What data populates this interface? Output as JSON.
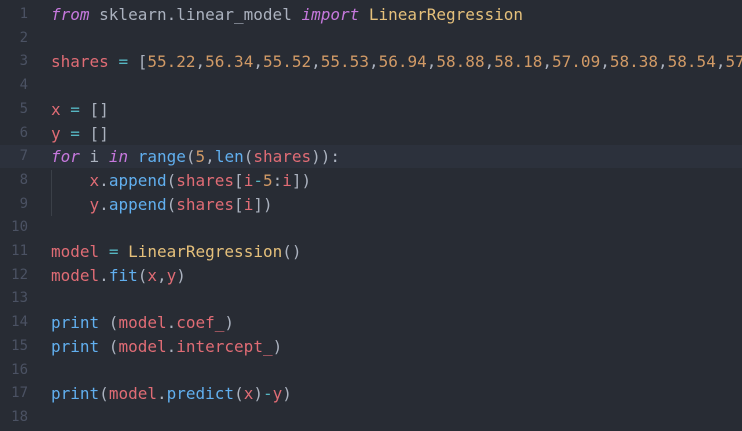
{
  "editor": {
    "language": "python",
    "current_line": 7,
    "colors": {
      "background": "#282c34",
      "keyword": "#c678dd",
      "variable": "#e06c75",
      "number": "#d19a66",
      "function": "#61afef",
      "class": "#e5c07b",
      "operator": "#56b6c2",
      "line_number": "#4b5263"
    },
    "lines": [
      {
        "no": "1",
        "tokens": [
          {
            "t": "kw",
            "v": "from"
          },
          {
            "t": "plain",
            "v": " sklearn.linear_model "
          },
          {
            "t": "kw",
            "v": "import"
          },
          {
            "t": "plain",
            "v": " "
          },
          {
            "t": "cls",
            "v": "LinearRegression"
          }
        ]
      },
      {
        "no": "2",
        "tokens": []
      },
      {
        "no": "3",
        "tokens": [
          {
            "t": "var",
            "v": "shares"
          },
          {
            "t": "plain",
            "v": " "
          },
          {
            "t": "op",
            "v": "="
          },
          {
            "t": "plain",
            "v": " ["
          },
          {
            "t": "num",
            "v": "55.22"
          },
          {
            "t": "plain",
            "v": ","
          },
          {
            "t": "num",
            "v": "56.34"
          },
          {
            "t": "plain",
            "v": ","
          },
          {
            "t": "num",
            "v": "55.52"
          },
          {
            "t": "plain",
            "v": ","
          },
          {
            "t": "num",
            "v": "55.53"
          },
          {
            "t": "plain",
            "v": ","
          },
          {
            "t": "num",
            "v": "56.94"
          },
          {
            "t": "plain",
            "v": ","
          },
          {
            "t": "num",
            "v": "58.88"
          },
          {
            "t": "plain",
            "v": ","
          },
          {
            "t": "num",
            "v": "58.18"
          },
          {
            "t": "plain",
            "v": ","
          },
          {
            "t": "num",
            "v": "57.09"
          },
          {
            "t": "plain",
            "v": ","
          },
          {
            "t": "num",
            "v": "58.38"
          },
          {
            "t": "plain",
            "v": ","
          },
          {
            "t": "num",
            "v": "58.54"
          },
          {
            "t": "plain",
            "v": ","
          },
          {
            "t": "num",
            "v": "57"
          }
        ]
      },
      {
        "no": "4",
        "tokens": []
      },
      {
        "no": "5",
        "tokens": [
          {
            "t": "var",
            "v": "x"
          },
          {
            "t": "plain",
            "v": " "
          },
          {
            "t": "op",
            "v": "="
          },
          {
            "t": "plain",
            "v": " []"
          }
        ]
      },
      {
        "no": "6",
        "tokens": [
          {
            "t": "var",
            "v": "y"
          },
          {
            "t": "plain",
            "v": " "
          },
          {
            "t": "op",
            "v": "="
          },
          {
            "t": "plain",
            "v": " []"
          }
        ]
      },
      {
        "no": "7",
        "tokens": [
          {
            "t": "kw",
            "v": "for"
          },
          {
            "t": "plain",
            "v": " i "
          },
          {
            "t": "kw",
            "v": "in"
          },
          {
            "t": "plain",
            "v": " "
          },
          {
            "t": "fn",
            "v": "range"
          },
          {
            "t": "plain",
            "v": "("
          },
          {
            "t": "num",
            "v": "5"
          },
          {
            "t": "plain",
            "v": ","
          },
          {
            "t": "fn",
            "v": "len"
          },
          {
            "t": "plain",
            "v": "("
          },
          {
            "t": "var",
            "v": "shares"
          },
          {
            "t": "plain",
            "v": ")):"
          }
        ]
      },
      {
        "no": "8",
        "tokens": [
          {
            "t": "plain",
            "v": "    "
          },
          {
            "t": "var",
            "v": "x"
          },
          {
            "t": "plain",
            "v": "."
          },
          {
            "t": "fn",
            "v": "append"
          },
          {
            "t": "plain",
            "v": "("
          },
          {
            "t": "var",
            "v": "shares"
          },
          {
            "t": "plain",
            "v": "["
          },
          {
            "t": "var",
            "v": "i"
          },
          {
            "t": "op",
            "v": "-"
          },
          {
            "t": "num",
            "v": "5"
          },
          {
            "t": "plain",
            "v": ":"
          },
          {
            "t": "var",
            "v": "i"
          },
          {
            "t": "plain",
            "v": "])"
          }
        ]
      },
      {
        "no": "9",
        "tokens": [
          {
            "t": "plain",
            "v": "    "
          },
          {
            "t": "var",
            "v": "y"
          },
          {
            "t": "plain",
            "v": "."
          },
          {
            "t": "fn",
            "v": "append"
          },
          {
            "t": "plain",
            "v": "("
          },
          {
            "t": "var",
            "v": "shares"
          },
          {
            "t": "plain",
            "v": "["
          },
          {
            "t": "var",
            "v": "i"
          },
          {
            "t": "plain",
            "v": "])"
          }
        ]
      },
      {
        "no": "10",
        "tokens": []
      },
      {
        "no": "11",
        "tokens": [
          {
            "t": "var",
            "v": "model"
          },
          {
            "t": "plain",
            "v": " "
          },
          {
            "t": "op",
            "v": "="
          },
          {
            "t": "plain",
            "v": " "
          },
          {
            "t": "cls",
            "v": "LinearRegression"
          },
          {
            "t": "plain",
            "v": "()"
          }
        ]
      },
      {
        "no": "12",
        "tokens": [
          {
            "t": "var",
            "v": "model"
          },
          {
            "t": "plain",
            "v": "."
          },
          {
            "t": "fn",
            "v": "fit"
          },
          {
            "t": "plain",
            "v": "("
          },
          {
            "t": "var",
            "v": "x"
          },
          {
            "t": "plain",
            "v": ","
          },
          {
            "t": "var",
            "v": "y"
          },
          {
            "t": "plain",
            "v": ")"
          }
        ]
      },
      {
        "no": "13",
        "tokens": []
      },
      {
        "no": "14",
        "tokens": [
          {
            "t": "fn",
            "v": "print"
          },
          {
            "t": "plain",
            "v": " ("
          },
          {
            "t": "var",
            "v": "model"
          },
          {
            "t": "plain",
            "v": "."
          },
          {
            "t": "var",
            "v": "coef_"
          },
          {
            "t": "plain",
            "v": ")"
          }
        ]
      },
      {
        "no": "15",
        "tokens": [
          {
            "t": "fn",
            "v": "print"
          },
          {
            "t": "plain",
            "v": " ("
          },
          {
            "t": "var",
            "v": "model"
          },
          {
            "t": "plain",
            "v": "."
          },
          {
            "t": "var",
            "v": "intercept_"
          },
          {
            "t": "plain",
            "v": ")"
          }
        ]
      },
      {
        "no": "16",
        "tokens": []
      },
      {
        "no": "17",
        "tokens": [
          {
            "t": "fn",
            "v": "print"
          },
          {
            "t": "plain",
            "v": "("
          },
          {
            "t": "var",
            "v": "model"
          },
          {
            "t": "plain",
            "v": "."
          },
          {
            "t": "fn",
            "v": "predict"
          },
          {
            "t": "plain",
            "v": "("
          },
          {
            "t": "var",
            "v": "x"
          },
          {
            "t": "plain",
            "v": ")"
          },
          {
            "t": "op",
            "v": "-"
          },
          {
            "t": "var",
            "v": "y"
          },
          {
            "t": "plain",
            "v": ")"
          }
        ]
      },
      {
        "no": "18",
        "tokens": []
      }
    ]
  }
}
